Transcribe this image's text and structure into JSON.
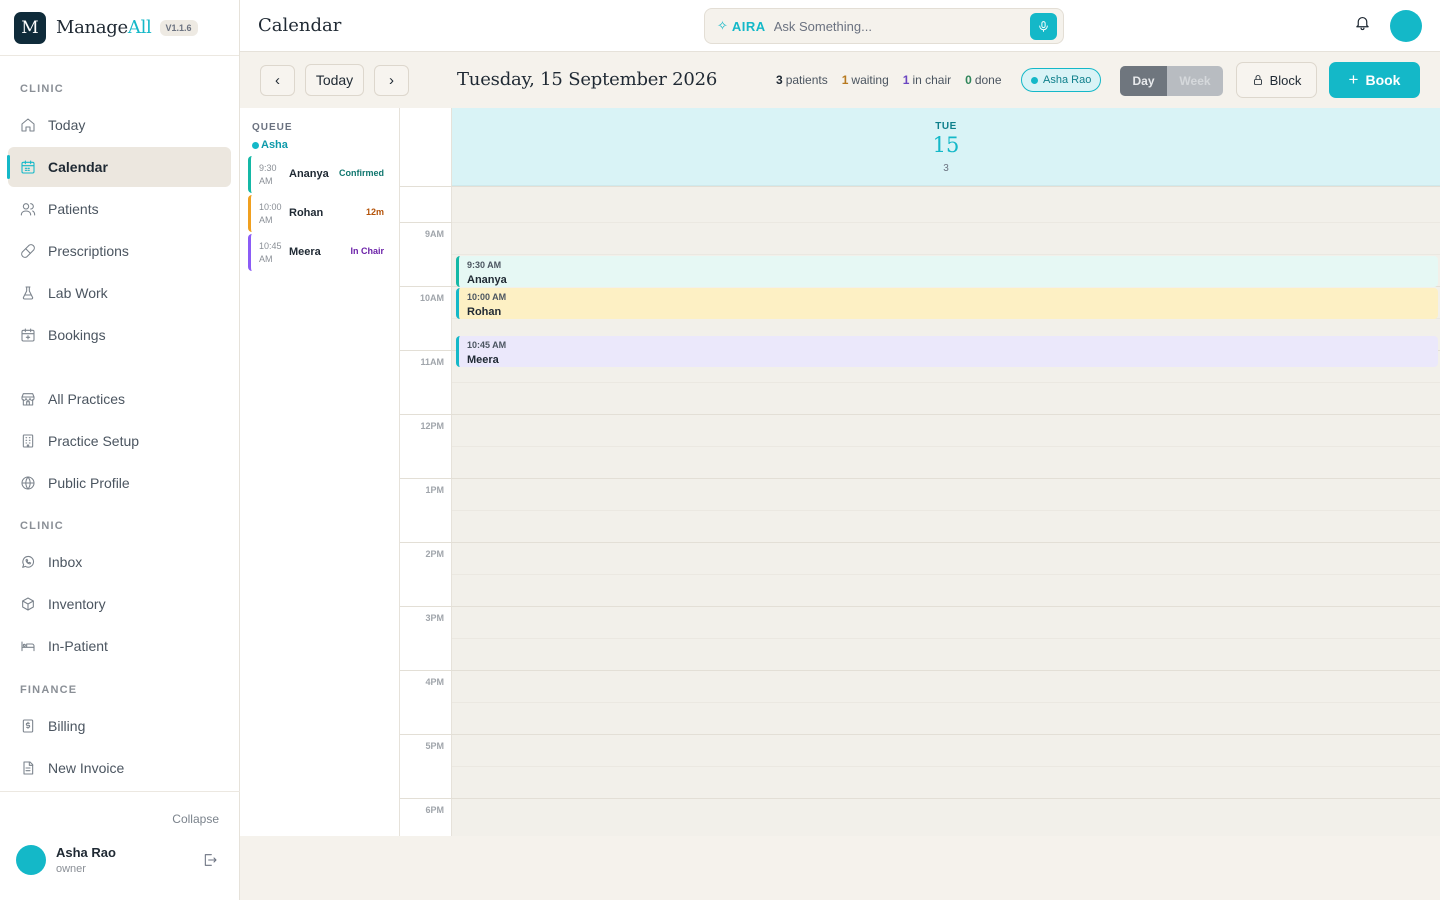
{
  "brand": {
    "logo_letter": "M",
    "name_main": "Manage",
    "name_accent": "All",
    "version": "V1.1.6"
  },
  "sidebar": {
    "sections": [
      {
        "label": "CLINIC"
      },
      {
        "label": "CLINIC"
      },
      {
        "label": "FINANCE"
      }
    ],
    "items": [
      {
        "label": "Today",
        "icon": "home-icon"
      },
      {
        "label": "Calendar",
        "icon": "calendar-icon",
        "active": true
      },
      {
        "label": "Patients",
        "icon": "users-icon"
      },
      {
        "label": "Prescriptions",
        "icon": "pill-icon"
      },
      {
        "label": "Lab Work",
        "icon": "flask-icon"
      },
      {
        "label": "Bookings",
        "icon": "calendar-plus-icon"
      },
      {
        "label": "All Practices",
        "icon": "store-icon"
      },
      {
        "label": "Practice Setup",
        "icon": "building-icon"
      },
      {
        "label": "Public Profile",
        "icon": "globe-icon"
      },
      {
        "label": "Inbox",
        "icon": "whatsapp-icon"
      },
      {
        "label": "Inventory",
        "icon": "box-icon"
      },
      {
        "label": "In-Patient",
        "icon": "bed-icon"
      },
      {
        "label": "Billing",
        "icon": "dollar-doc-icon"
      },
      {
        "label": "New Invoice",
        "icon": "invoice-icon"
      }
    ],
    "collapse_label": "Collapse",
    "user": {
      "name": "Asha Rao",
      "role": "owner"
    }
  },
  "header": {
    "title": "Calendar",
    "aira": {
      "label": "AIRA",
      "placeholder": "Ask Something..."
    }
  },
  "toolbar": {
    "today_label": "Today",
    "prev_label": "‹",
    "next_label": "›",
    "date": "Tuesday, 15 September 2026",
    "stats": [
      {
        "value": "3",
        "label": "patients"
      },
      {
        "value": "1",
        "label": "waiting"
      },
      {
        "value": "1",
        "label": "in chair"
      },
      {
        "value": "0",
        "label": "done"
      }
    ],
    "doctor_chip": "Asha Rao",
    "view_day": "Day",
    "view_week": "Week",
    "view_selected": "Day",
    "block_label": "Block",
    "book_label": "Book"
  },
  "queue": {
    "title": "QUEUE",
    "doctor": "Asha",
    "items": [
      {
        "time": "9:30 AM",
        "name": "Ananya",
        "status": "Confirmed",
        "color": "#14b8a6"
      },
      {
        "time": "10:00 AM",
        "name": "Rohan",
        "status": "12m",
        "color": "#f0a020"
      },
      {
        "time": "10:45 AM",
        "name": "Meera",
        "status": "In Chair",
        "color": "#8b5cf6"
      }
    ]
  },
  "calendar": {
    "day_of_week": "TUE",
    "day_number": "15",
    "appointment_count": "3",
    "hours": [
      "9AM",
      "10AM",
      "11AM",
      "12PM",
      "1PM",
      "2PM",
      "3PM",
      "4PM",
      "5PM",
      "6PM"
    ],
    "events": [
      {
        "time": "9:30 AM",
        "name": "Ananya"
      },
      {
        "time": "10:00 AM",
        "name": "Rohan"
      },
      {
        "time": "10:45 AM",
        "name": "Meera"
      }
    ]
  },
  "colors": {
    "accent": "#14b8c8",
    "sidebar_active_bg": "#ece7df",
    "page_bg": "#f5f2ec"
  }
}
